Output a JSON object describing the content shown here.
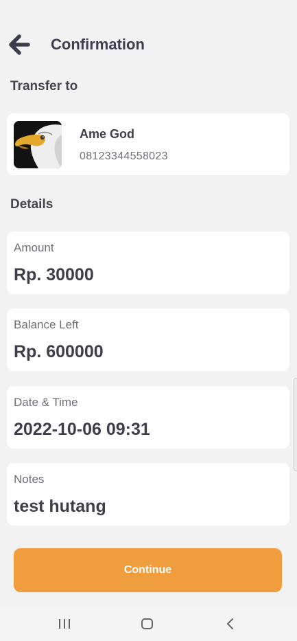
{
  "header": {
    "back_icon": "arrow-left-icon",
    "title": "Confirmation"
  },
  "transfer": {
    "section_label": "Transfer to",
    "recipient": {
      "avatar_icon": "eagle-avatar",
      "name": "Ame God",
      "phone": "08123344558023"
    }
  },
  "details": {
    "section_label": "Details",
    "items": [
      {
        "label": "Amount",
        "value": "Rp. 30000"
      },
      {
        "label": "Balance Left",
        "value": "Rp. 600000"
      },
      {
        "label": "Date & Time",
        "value": "2022-10-06 09:31"
      },
      {
        "label": "Notes",
        "value": "test hutang"
      }
    ]
  },
  "actions": {
    "continue_label": "Continue"
  },
  "system_nav": {
    "recents_icon": "recents-icon",
    "home_icon": "home-icon",
    "back_icon": "nav-back-icon"
  },
  "colors": {
    "background": "#f2f2f2",
    "card": "#ffffff",
    "accent": "#ef9d3d",
    "text_primary": "#3e3e48",
    "text_secondary": "#6e6e78"
  }
}
